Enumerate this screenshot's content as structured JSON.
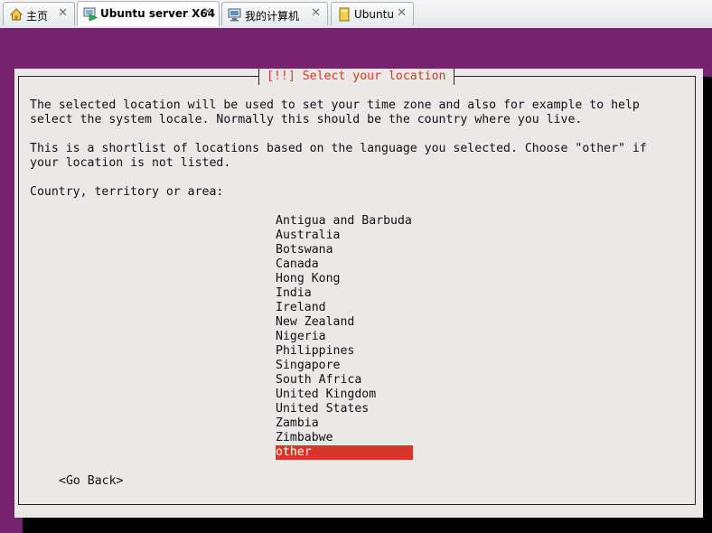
{
  "tabs": [
    {
      "label": "主页",
      "icon": "home-icon",
      "active": false
    },
    {
      "label": "Ubuntu server X64",
      "icon": "vm-power-icon",
      "active": true
    },
    {
      "label": "我的计算机",
      "icon": "computer-icon",
      "active": false
    },
    {
      "label": "Ubuntu",
      "icon": "vm-icon",
      "active": false
    }
  ],
  "close_glyph": "✕",
  "dialog": {
    "title": "[!!] Select your location",
    "paragraph1_line1": "The selected location will be used to set your time zone and also for example to help",
    "paragraph1_line2": "select the system locale. Normally this should be the country where you live.",
    "paragraph2_line1": "This is a shortlist of locations based on the language you selected. Choose \"other\" if",
    "paragraph2_line2": "your location is not listed.",
    "prompt": "Country, territory or area:",
    "locations": [
      "Antigua and Barbuda",
      "Australia",
      "Botswana",
      "Canada",
      "Hong Kong",
      "India",
      "Ireland",
      "New Zealand",
      "Nigeria",
      "Philippines",
      "Singapore",
      "South Africa",
      "United Kingdom",
      "United States",
      "Zambia",
      "Zimbabwe",
      "other"
    ],
    "selected_location": "other",
    "go_back_label": "<Go Back>"
  },
  "colors": {
    "desktop": "#76226f",
    "dialog_bg": "#ede8e8",
    "title_text": "#d23a21",
    "selection": "#d4372a"
  }
}
